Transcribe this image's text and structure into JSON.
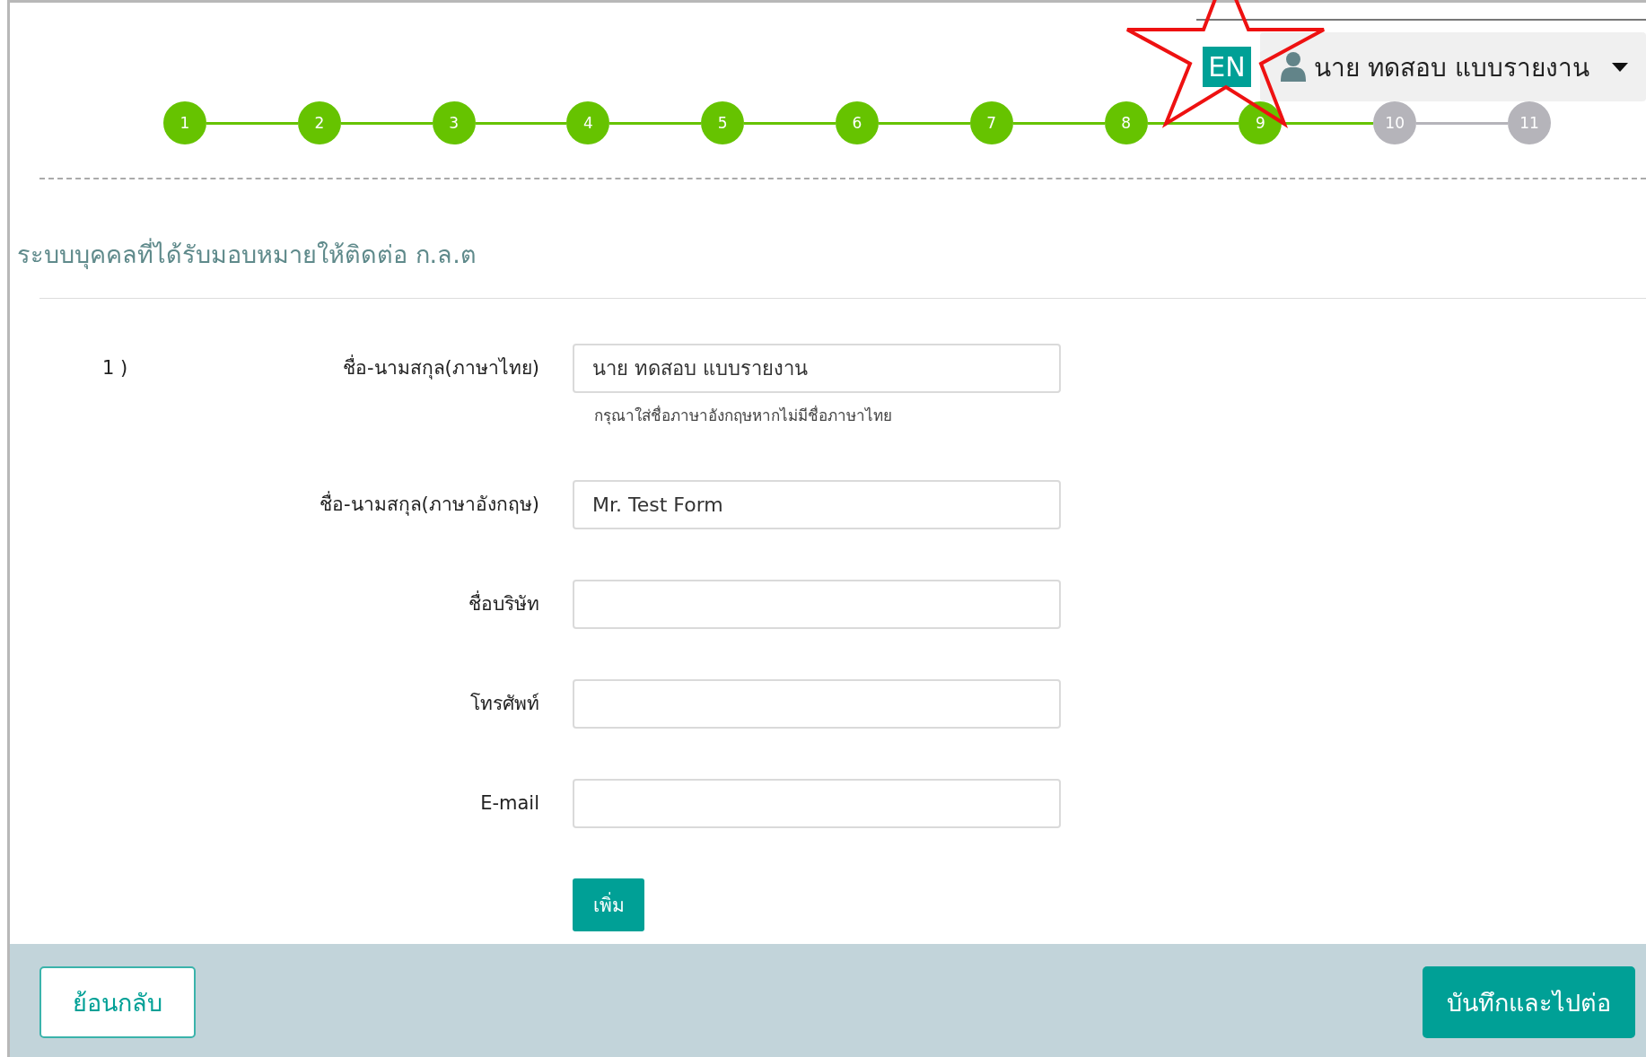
{
  "header": {
    "language_button": "EN",
    "user_menu": {
      "name": "นาย ทดสอบ แบบรายงาน"
    }
  },
  "steps": [
    {
      "label": "1",
      "done": true
    },
    {
      "label": "2",
      "done": true
    },
    {
      "label": "3",
      "done": true
    },
    {
      "label": "4",
      "done": true
    },
    {
      "label": "5",
      "done": true
    },
    {
      "label": "6",
      "done": true
    },
    {
      "label": "7",
      "done": true
    },
    {
      "label": "8",
      "done": true
    },
    {
      "label": "9",
      "done": true
    },
    {
      "label": "10",
      "done": false
    },
    {
      "label": "11",
      "done": false
    }
  ],
  "section_title": "ระบบบุคคลที่ได้รับมอบหมายให้ติดต่อ ก.ล.ต",
  "form": {
    "item_number": "1 )",
    "fields": [
      {
        "label": "ชื่อ-นามสกุล(ภาษาไทย)",
        "value": "นาย ทดสอบ แบบรายงาน",
        "hint": "กรุณาใส่ชื่อภาษาอังกฤษหากไม่มีชื่อภาษาไทย"
      },
      {
        "label": "ชื่อ-นามสกุล(ภาษาอังกฤษ)",
        "value": "Mr. Test Form"
      },
      {
        "label": "ชื่อบริษัท"
      },
      {
        "label": "โทรศัพท์"
      },
      {
        "label": "E-mail"
      }
    ],
    "add_button": "เพิ่ม"
  },
  "footer": {
    "back_button": "ย้อนกลับ",
    "save_button": "บันทึกและไปต่อ"
  }
}
